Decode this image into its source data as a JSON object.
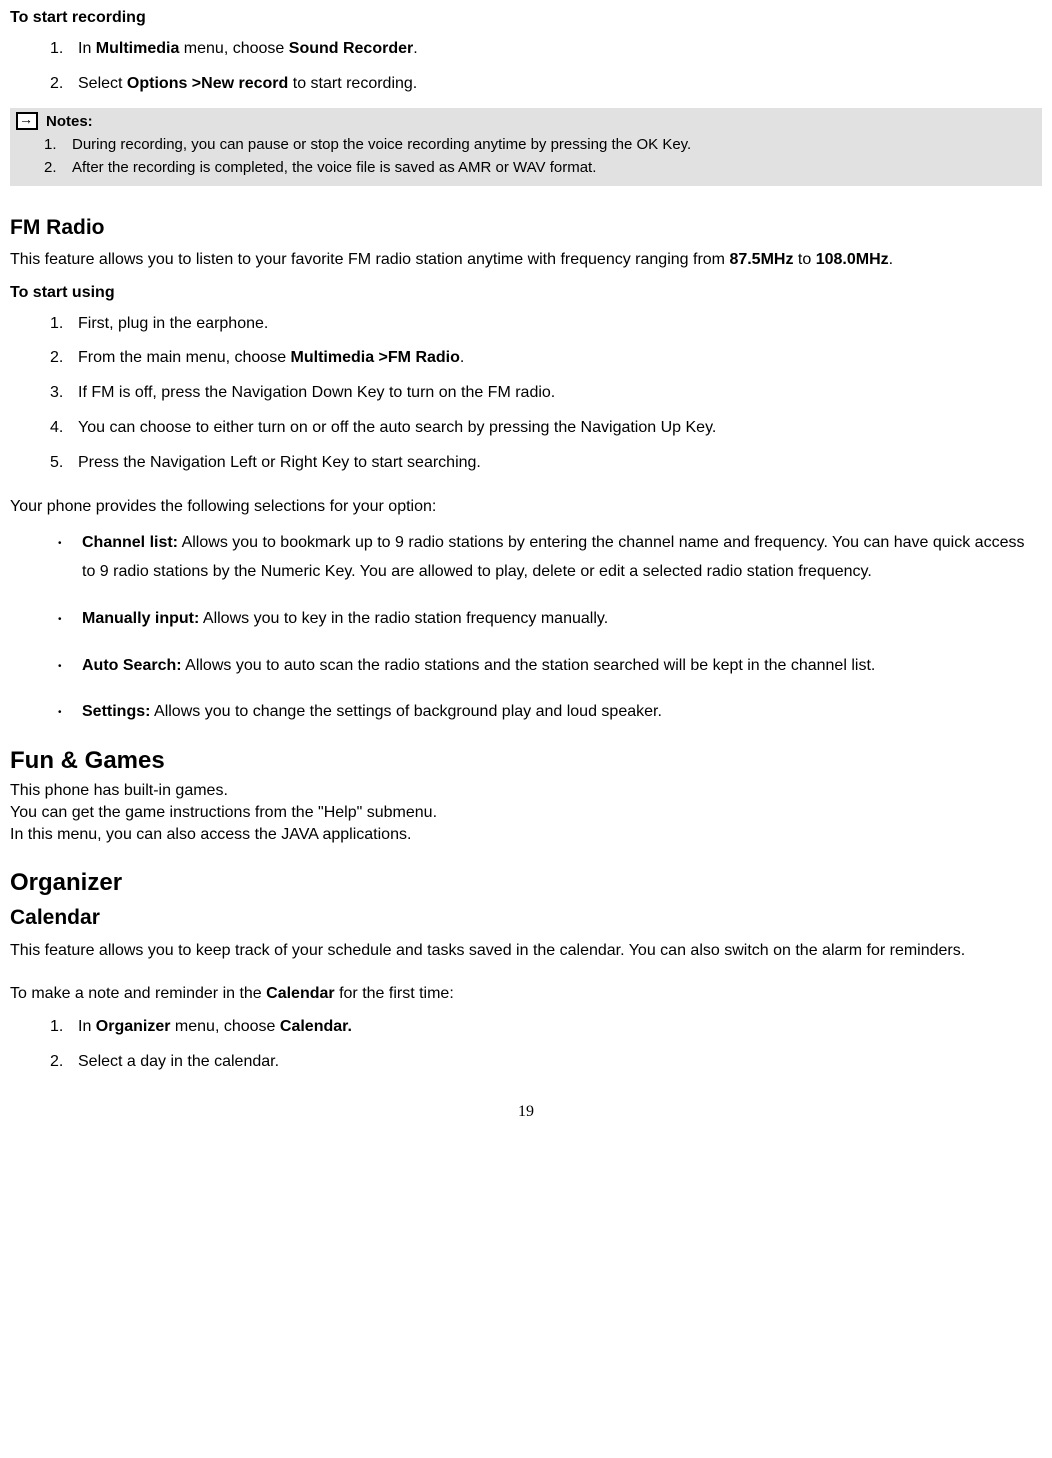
{
  "recording": {
    "heading": "To start recording",
    "steps": [
      {
        "num": "1.",
        "pre": "In ",
        "b1": "Multimedia",
        "mid": " menu, choose ",
        "b2": "Sound Recorder",
        "post": "."
      },
      {
        "num": "2.",
        "pre": "Select ",
        "b1": "Options >New record",
        "post": " to start recording."
      }
    ]
  },
  "notes": {
    "title": "Notes:",
    "items": [
      {
        "num": "1.",
        "text": "During recording, you can pause or stop the voice recording anytime by pressing the OK Key."
      },
      {
        "num": "2.",
        "text": "After the recording is completed, the voice file is saved as AMR or WAV format."
      }
    ]
  },
  "fmradio": {
    "heading": "FM Radio",
    "intro_pre": "This feature allows you to listen to your favorite FM radio station anytime with frequency ranging from ",
    "intro_b1": "87.5MHz",
    "intro_mid": " to ",
    "intro_b2": "108.0MHz",
    "intro_post": ".",
    "start_heading": "To start using",
    "steps": [
      {
        "num": "1.",
        "text": "First, plug in the earphone."
      },
      {
        "num": "2.",
        "pre": "From the main menu, choose ",
        "b": "Multimedia >FM Radio",
        "post": "."
      },
      {
        "num": "3.",
        "text": "If FM is off, press the Navigation Down Key to turn on the FM radio."
      },
      {
        "num": "4.",
        "text": "You can choose to either turn on or off the auto search by pressing the Navigation Up Key."
      },
      {
        "num": "5.",
        "text": "Press the Navigation Left or Right Key to start searching."
      }
    ],
    "options_intro": "Your phone provides the following selections for your option:",
    "options": [
      {
        "b": "Channel list:",
        "text": " Allows you to bookmark up to 9 radio stations by entering the channel name and frequency. You can have quick access to 9 radio stations by the Numeric Key. You are allowed to play, delete or edit a selected radio station frequency."
      },
      {
        "b": "Manually input:",
        "text": " Allows you to key in the radio station frequency manually."
      },
      {
        "b": "Auto Search:",
        "text": " Allows you to auto scan the radio stations and the station searched will be kept in the channel list."
      },
      {
        "b": "Settings:",
        "text": " Allows you to change the settings of background play and loud speaker."
      }
    ]
  },
  "fungames": {
    "heading": "Fun & Games",
    "line1": "This phone has built-in games.",
    "line2": "You can get the game instructions from the \"Help\" submenu.",
    "line3": "In this menu, you can also access the JAVA applications."
  },
  "organizer": {
    "heading": "Organizer",
    "calendar_heading": "Calendar",
    "calendar_intro": "This feature allows you to keep track of your schedule and tasks saved in the calendar. You can also switch on the alarm for reminders.",
    "make_note_pre": "To make a note and reminder in the ",
    "make_note_b": "Calendar",
    "make_note_post": " for the first time:",
    "steps": [
      {
        "num": "1.",
        "pre": "In ",
        "b1": "Organizer",
        "mid": " menu, choose ",
        "b2": "Calendar.",
        "post": ""
      },
      {
        "num": "2.",
        "text": "Select a day in the calendar."
      }
    ]
  },
  "page_number": "19",
  "bullet": "•"
}
